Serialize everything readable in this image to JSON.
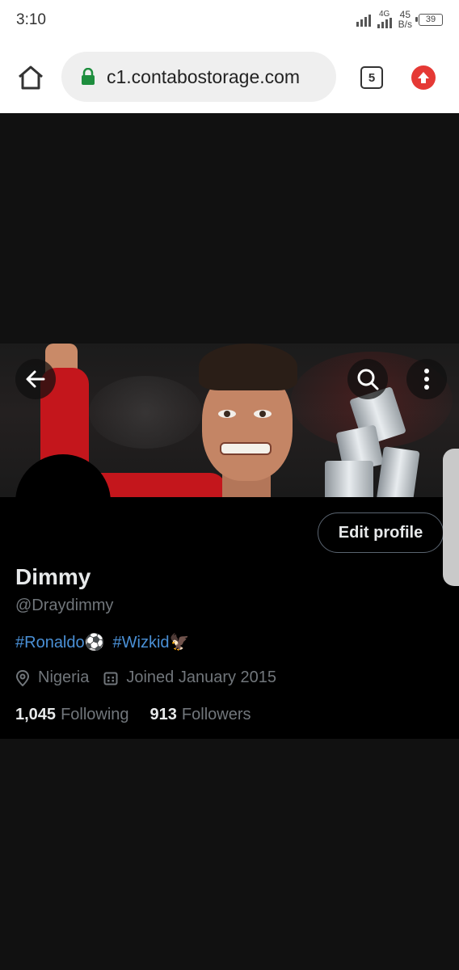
{
  "status_bar": {
    "time": "3:10",
    "network_badge": "4G",
    "net_speed_value": "45",
    "net_speed_unit": "B/s",
    "battery_level": "39"
  },
  "browser": {
    "url": "c1.contabostorage.com",
    "tab_count": "5",
    "icons": [
      "home-icon",
      "lock-icon",
      "tab-switcher-icon",
      "update-icon"
    ],
    "accent_update": "#e53935",
    "lock_color": "#1e8e3e"
  },
  "header_icons": [
    "back-arrow-icon",
    "search-icon",
    "more-vertical-icon"
  ],
  "profile": {
    "display_name": "Dimmy",
    "handle": "@Draydimmy",
    "bio_tags": [
      {
        "tag": "#Ronaldo",
        "emoji": "⚽"
      },
      {
        "tag": "#Wizkid",
        "emoji": "🦅"
      }
    ],
    "location": "Nigeria",
    "joined": "Joined January 2015",
    "following_count": "1,045",
    "following_label": "Following",
    "followers_count": "913",
    "followers_label": "Followers",
    "edit_button_label": "Edit profile",
    "hashtag_color": "#4a90d6"
  }
}
